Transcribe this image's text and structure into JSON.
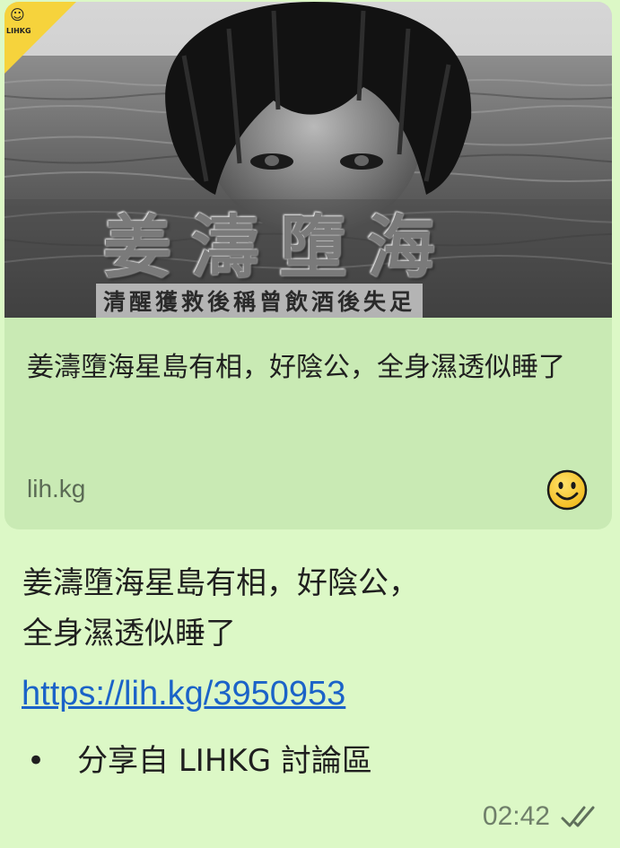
{
  "preview": {
    "badge_label": "LIHKG",
    "badge_icon": "smiley-icon",
    "image_title": "姜濤墮海",
    "image_subtitle": "清醒獲救後稱曾飲酒後失足",
    "title": "姜濤墮海星島有相，好陰公，全身濕透似睡了",
    "domain": "lih.kg",
    "emoji_icon": "smiley-emoji-icon"
  },
  "message": {
    "text_line1": "姜濤墮海星島有相，好陰公，",
    "text_line2": "全身濕透似睡了",
    "link": "https://lih.kg/3950953",
    "share_bullet": "•",
    "share_text": "分享自 LIHKG 討論區",
    "time": "02:42",
    "status_icon": "double-check-icon"
  },
  "colors": {
    "bubble": "#dcf8c6",
    "card": "#c9eab4",
    "link": "#1b63c8",
    "badge": "#f6d33c"
  }
}
